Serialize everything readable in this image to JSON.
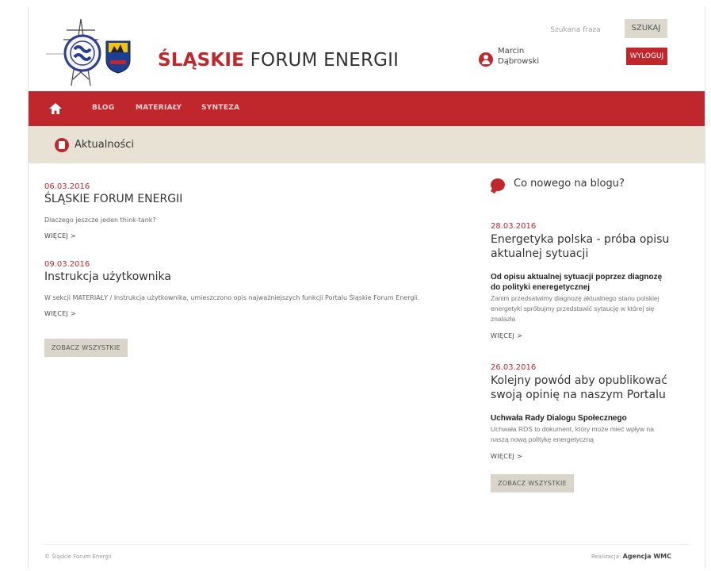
{
  "header": {
    "site_title_red": "ŚLĄSKIE",
    "site_title_rest": "FORUM ENERGII",
    "search_placeholder": "Szukana fraza",
    "search_button": "SZUKAJ",
    "user_first_name": "Marcin",
    "user_last_name": "Dąbrowski",
    "logout_button": "WYLOGUJ",
    "accent_color": "#c0272d"
  },
  "nav": {
    "items": [
      {
        "label": "BLOG"
      },
      {
        "label": "MATERIAŁY"
      },
      {
        "label": "SYNTEZA"
      }
    ],
    "home_icon": "home-icon"
  },
  "section": {
    "title": "Aktualności",
    "icon": "document-icon"
  },
  "news": {
    "items": [
      {
        "date": "06.03.2016",
        "title": "ŚLĄSKIE FORUM ENERGII",
        "excerpt": "Dlaczego jeszcze jeden think-tank?",
        "more": "WIĘCEJ >"
      },
      {
        "date": "09.03.2016",
        "title": "Instrukcja użytkownika",
        "excerpt": "W sekcji MATERIAŁY / Instrukcja użytkownika, umieszczono opis najważniejszych funkcji Portalu Śląskie Forum Energii.",
        "more": "WIĘCEJ >"
      }
    ],
    "see_all": "ZOBACZ WSZYSTKIE"
  },
  "blog": {
    "heading": "Co nowego na blogu?",
    "icon": "speech-bubble-icon",
    "items": [
      {
        "date": "28.03.2016",
        "title": "Energetyka polska - próba opisu aktualnej sytuacji",
        "subtitle": "Od opisu aktualnej sytuacji poprzez diagnozę do polityki eneregetycznej",
        "excerpt": "Zanim przedsatwimy diagnozę aktualnego stanu polskiej energetyki spróbujmy przedstawić sytaucję w której się znalazła",
        "more": "WIĘCEJ >"
      },
      {
        "date": "26.03.2016",
        "title": "Kolejny powód aby opublikować swoją opinię na naszym Portalu",
        "subtitle": "Uchwała Rady Dialogu Społecznego",
        "excerpt": "Uchwała RDS to dokument, który może mieć wpływ na naszą nową politykę energetyczną",
        "more": "WIĘCEJ >"
      }
    ],
    "see_all": "ZOBACZ WSZYSTKIE"
  },
  "footer": {
    "copyright": "© Śląskie Forum Energii",
    "realization_label": "Realizacja:",
    "agency": "Agencja WMC"
  }
}
